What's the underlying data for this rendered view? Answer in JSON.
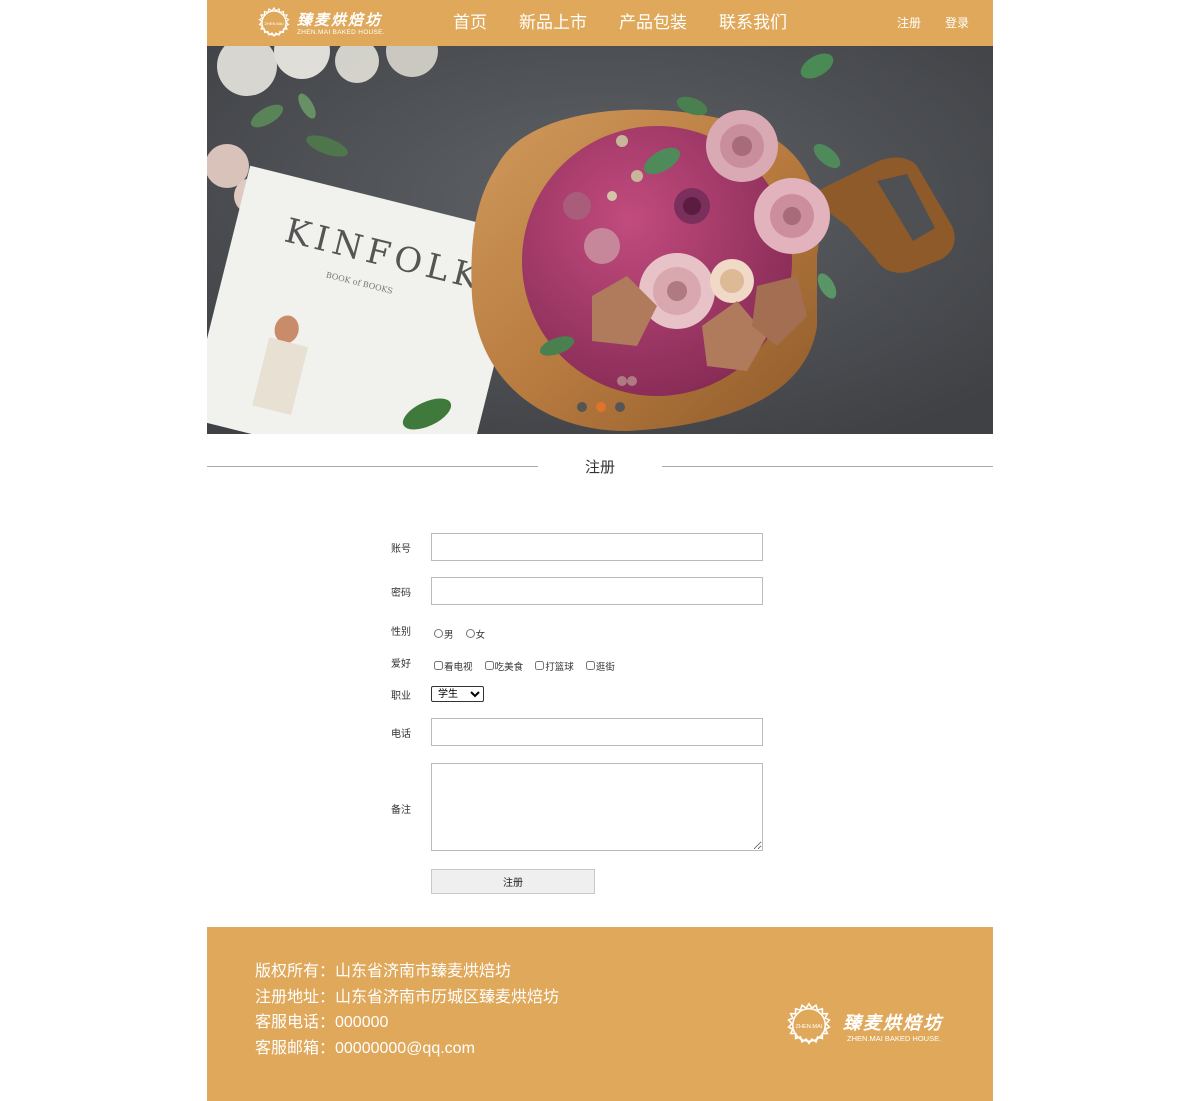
{
  "brand": {
    "name_cn": "臻麦烘焙坊",
    "name_en": "ZHEN.MAI BAKED HOUSE.",
    "seal_text": "ZHEN.MAI"
  },
  "nav": {
    "items": [
      "首页",
      "新品上市",
      "产品包装",
      "联系我们"
    ]
  },
  "user_links": {
    "register": "注册",
    "login": "登录"
  },
  "banner": {
    "book_title": "KINFOLK",
    "book_subtitle": "BOOK of BOOKS",
    "dots": 3,
    "active_dot": 1
  },
  "section": {
    "title": "注册"
  },
  "form": {
    "account_label": "账号",
    "password_label": "密码",
    "gender_label": "性别",
    "gender_options": [
      "男",
      "女"
    ],
    "hobby_label": "爱好",
    "hobby_options": [
      "看电视",
      "吃美食",
      "打篮球",
      "逛街"
    ],
    "job_label": "职业",
    "job_selected": "学生",
    "phone_label": "电话",
    "remark_label": "备注",
    "submit_label": "注册"
  },
  "footer": {
    "lines": [
      "版权所有：山东省济南市臻麦烘焙坊",
      "注册地址：山东省济南市历城区臻麦烘焙坊",
      "客服电话：000000",
      "客服邮箱：00000000@qq.com"
    ]
  },
  "colors": {
    "accent": "#dfa85a",
    "active_dot": "#e0742b"
  }
}
